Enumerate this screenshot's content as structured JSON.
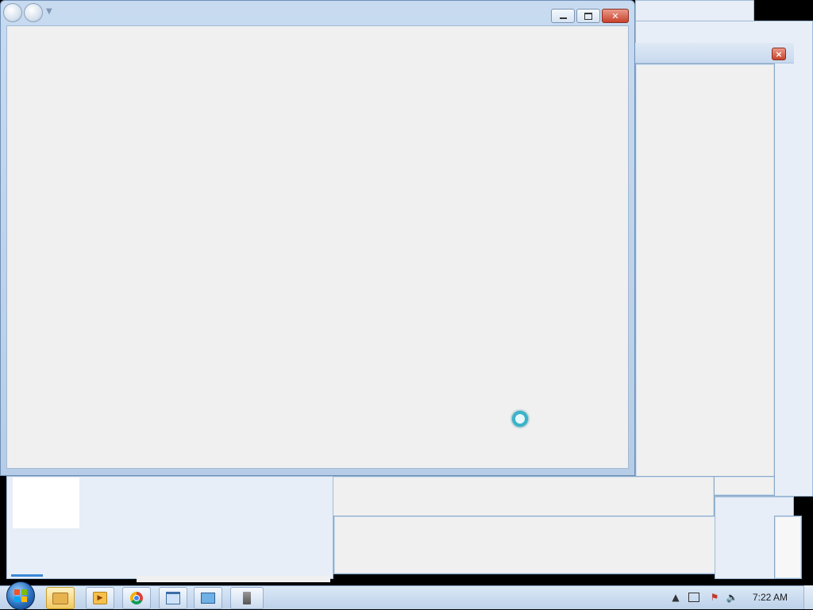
{
  "taskbar": {
    "clock": "7:22 AM",
    "items": [
      {
        "name": "file-explorer",
        "icon": "folder-icon",
        "active": true
      },
      {
        "name": "media-player",
        "icon": "media-player-icon",
        "active": false
      },
      {
        "name": "chrome",
        "icon": "chrome-icon",
        "active": false
      },
      {
        "name": "window-app",
        "icon": "window-icon",
        "active": false
      },
      {
        "name": "monitor-app",
        "icon": "monitor-icon",
        "active": false
      },
      {
        "name": "usb-app",
        "icon": "usb-icon",
        "active": false
      }
    ],
    "tray": [
      "chevron-up-icon",
      "network-icon",
      "action-center-flag-icon",
      "volume-icon"
    ]
  },
  "colors": {
    "window_client": "#f0f0f0",
    "title_frame": "#c7daf0",
    "close_button": "#c8432b",
    "busy_cursor": "#3bb3c8"
  },
  "main_window": {
    "title": "",
    "state": "busy"
  }
}
